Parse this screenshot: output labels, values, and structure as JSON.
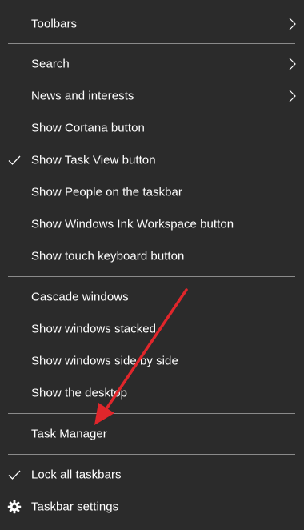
{
  "menu": {
    "items": [
      {
        "label": "Toolbars",
        "submenu": true,
        "checked": false
      },
      {
        "label": "Search",
        "submenu": true,
        "checked": false
      },
      {
        "label": "News and interests",
        "submenu": true,
        "checked": false
      },
      {
        "label": "Show Cortana button",
        "submenu": false,
        "checked": false
      },
      {
        "label": "Show Task View button",
        "submenu": false,
        "checked": true
      },
      {
        "label": "Show People on the taskbar",
        "submenu": false,
        "checked": false
      },
      {
        "label": "Show Windows Ink Workspace button",
        "submenu": false,
        "checked": false
      },
      {
        "label": "Show touch keyboard button",
        "submenu": false,
        "checked": false
      },
      {
        "label": "Cascade windows",
        "submenu": false,
        "checked": false
      },
      {
        "label": "Show windows stacked",
        "submenu": false,
        "checked": false
      },
      {
        "label": "Show windows side by side",
        "submenu": false,
        "checked": false
      },
      {
        "label": "Show the desktop",
        "submenu": false,
        "checked": false
      },
      {
        "label": "Task Manager",
        "submenu": false,
        "checked": false
      },
      {
        "label": "Lock all taskbars",
        "submenu": false,
        "checked": true
      },
      {
        "label": "Taskbar settings",
        "submenu": false,
        "checked": false,
        "icon": "gear-icon"
      }
    ]
  },
  "colors": {
    "background": "#2b2b2b",
    "text": "#ffffff",
    "separator": "#8a8a8a",
    "annotation_arrow": "#e0262b"
  },
  "icons": {
    "submenu": "chevron-right-icon",
    "checked": "checkmark-icon",
    "settings": "gear-icon"
  }
}
